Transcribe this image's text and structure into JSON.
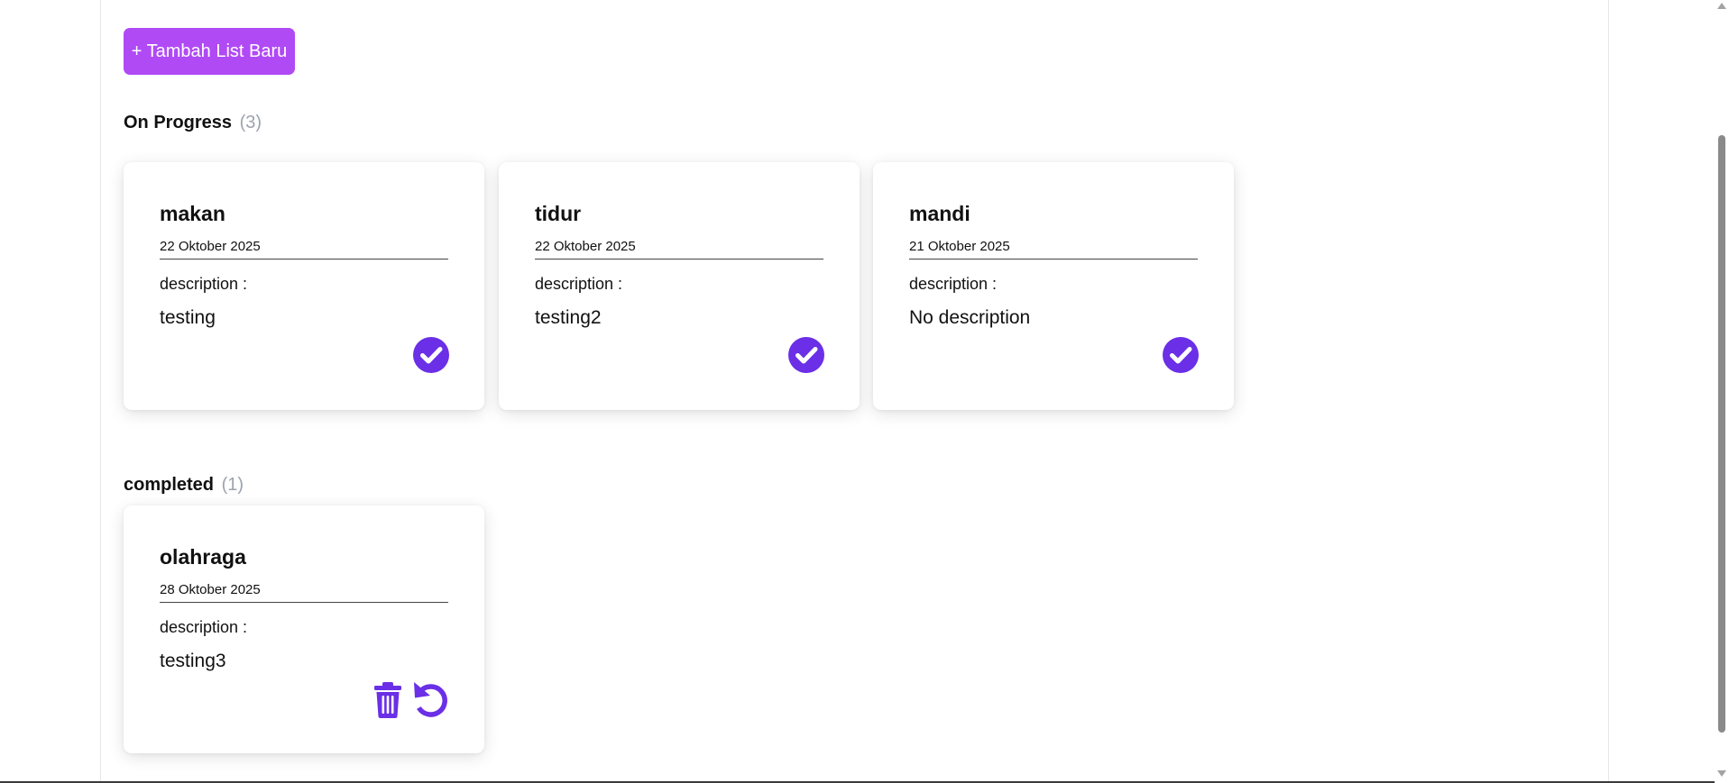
{
  "toolbar": {
    "add_label": "+ Tambah List Baru",
    "accent_color": "#b04af5"
  },
  "sections": {
    "on_progress": {
      "title": "On Progress",
      "count": "(3)"
    },
    "completed": {
      "title": "completed",
      "count": "(1)"
    }
  },
  "on_progress_cards": [
    {
      "title": "makan",
      "date": "22 Oktober 2025",
      "description_label": "description :",
      "description": "testing",
      "action_icon": "check-circle-icon"
    },
    {
      "title": "tidur",
      "date": "22 Oktober 2025",
      "description_label": "description :",
      "description": "testing2",
      "action_icon": "check-circle-icon"
    },
    {
      "title": "mandi",
      "date": "21 Oktober 2025",
      "description_label": "description :",
      "description": "No description",
      "action_icon": "check-circle-icon"
    }
  ],
  "completed_cards": [
    {
      "title": "olahraga",
      "date": "28 Oktober 2025",
      "description_label": "description :",
      "description": "testing3",
      "action_icons": [
        "trash-icon",
        "undo-icon"
      ]
    }
  ],
  "icon_color": "#6a2fe6"
}
